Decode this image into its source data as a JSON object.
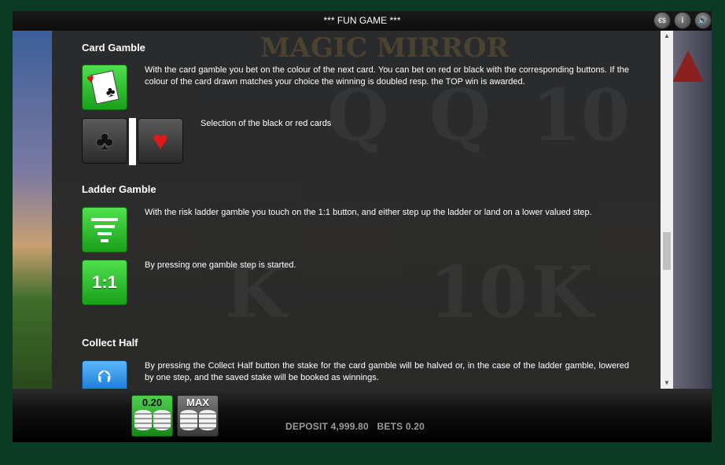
{
  "window": {
    "title": "*** FUN GAME ***"
  },
  "top_icons": [
    {
      "name": "paytable-icon",
      "glyph": "€$"
    },
    {
      "name": "info-icon",
      "glyph": "i"
    },
    {
      "name": "sound-icon",
      "glyph": "🔊"
    }
  ],
  "background": {
    "game_logo": "MAGIC MIRROR"
  },
  "help": {
    "card_gamble": {
      "title": "Card Gamble",
      "description": "With the card gamble you bet on the colour of the next card. You can bet on red or black with the corresponding buttons. If the colour of the card drawn matches your choice the winning is doubled resp. the TOP win is awarded.",
      "selection_text": "Selection of the black or red cards",
      "black_glyph": "♣",
      "red_glyph": "♥"
    },
    "ladder_gamble": {
      "title": "Ladder Gamble",
      "description": "With the risk ladder gamble you touch on the 1:1 button, and either step up the ladder or land on a lower valued step.",
      "one_to_one_label": "1:1",
      "one_to_one_text": "By pressing one gamble step is started."
    },
    "collect_half": {
      "title": "Collect Half",
      "description": "By pressing the Collect Half button the stake for the card gamble will be halved or, in the case of the ladder gamble, lowered by one step, and the saved stake will be booked as winnings."
    }
  },
  "bottom": {
    "bet_button_label": "0.20",
    "max_button_label": "MAX",
    "status_text": "DEPOSIT 4,999.80   BETS 0.20"
  },
  "colors": {
    "frame": "#0b3b24",
    "green_button": "#19a019",
    "status": "#9a9a9a"
  }
}
